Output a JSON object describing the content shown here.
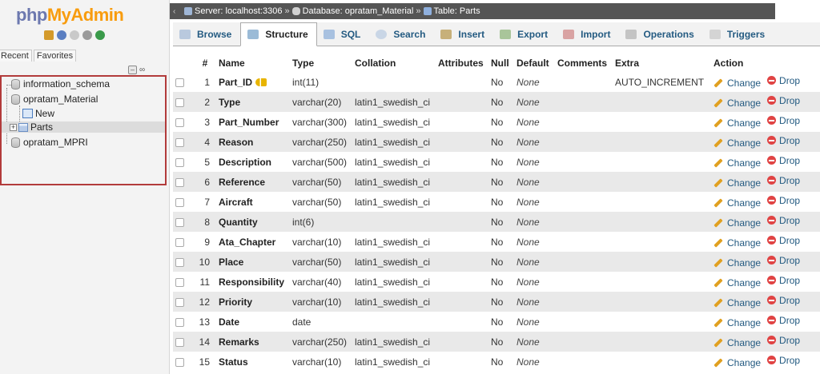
{
  "app": {
    "logo_php": "php",
    "logo_myadmin": "MyAdmin"
  },
  "nav": {
    "tabs": [
      "Recent",
      "Favorites"
    ],
    "databases": [
      {
        "name": "information_schema"
      },
      {
        "name": "opratam_Material"
      },
      {
        "name": "New"
      },
      {
        "name": "Parts"
      },
      {
        "name": "opratam_MPRI"
      }
    ]
  },
  "breadcrumb": {
    "server": "Server: localhost:3306",
    "database": "Database: opratam_Material",
    "table": "Table: Parts",
    "separator": "»"
  },
  "tabs": [
    {
      "label": "Browse",
      "icon": "browse-icon"
    },
    {
      "label": "Structure",
      "icon": "structure-icon",
      "active": true
    },
    {
      "label": "SQL",
      "icon": "sql-icon"
    },
    {
      "label": "Search",
      "icon": "search-icon"
    },
    {
      "label": "Insert",
      "icon": "insert-icon"
    },
    {
      "label": "Export",
      "icon": "export-icon"
    },
    {
      "label": "Import",
      "icon": "import-icon"
    },
    {
      "label": "Operations",
      "icon": "operations-icon"
    },
    {
      "label": "Triggers",
      "icon": "triggers-icon"
    }
  ],
  "table": {
    "headers": [
      "#",
      "Name",
      "Type",
      "Collation",
      "Attributes",
      "Null",
      "Default",
      "Comments",
      "Extra",
      "Action"
    ],
    "action_change": "Change",
    "action_drop": "Drop",
    "rows": [
      {
        "num": "1",
        "name": "Part_ID",
        "type": "int(11)",
        "collation": "",
        "null": "No",
        "default": "None",
        "extra": "AUTO_INCREMENT",
        "primary": true
      },
      {
        "num": "2",
        "name": "Type",
        "type": "varchar(20)",
        "collation": "latin1_swedish_ci",
        "null": "No",
        "default": "None",
        "extra": ""
      },
      {
        "num": "3",
        "name": "Part_Number",
        "type": "varchar(300)",
        "collation": "latin1_swedish_ci",
        "null": "No",
        "default": "None",
        "extra": ""
      },
      {
        "num": "4",
        "name": "Reason",
        "type": "varchar(250)",
        "collation": "latin1_swedish_ci",
        "null": "No",
        "default": "None",
        "extra": ""
      },
      {
        "num": "5",
        "name": "Description",
        "type": "varchar(500)",
        "collation": "latin1_swedish_ci",
        "null": "No",
        "default": "None",
        "extra": ""
      },
      {
        "num": "6",
        "name": "Reference",
        "type": "varchar(50)",
        "collation": "latin1_swedish_ci",
        "null": "No",
        "default": "None",
        "extra": ""
      },
      {
        "num": "7",
        "name": "Aircraft",
        "type": "varchar(50)",
        "collation": "latin1_swedish_ci",
        "null": "No",
        "default": "None",
        "extra": ""
      },
      {
        "num": "8",
        "name": "Quantity",
        "type": "int(6)",
        "collation": "",
        "null": "No",
        "default": "None",
        "extra": ""
      },
      {
        "num": "9",
        "name": "Ata_Chapter",
        "type": "varchar(10)",
        "collation": "latin1_swedish_ci",
        "null": "No",
        "default": "None",
        "extra": ""
      },
      {
        "num": "10",
        "name": "Place",
        "type": "varchar(50)",
        "collation": "latin1_swedish_ci",
        "null": "No",
        "default": "None",
        "extra": ""
      },
      {
        "num": "11",
        "name": "Responsibility",
        "type": "varchar(40)",
        "collation": "latin1_swedish_ci",
        "null": "No",
        "default": "None",
        "extra": ""
      },
      {
        "num": "12",
        "name": "Priority",
        "type": "varchar(10)",
        "collation": "latin1_swedish_ci",
        "null": "No",
        "default": "None",
        "extra": ""
      },
      {
        "num": "13",
        "name": "Date",
        "type": "date",
        "collation": "",
        "null": "No",
        "default": "None",
        "extra": ""
      },
      {
        "num": "14",
        "name": "Remarks",
        "type": "varchar(250)",
        "collation": "latin1_swedish_ci",
        "null": "No",
        "default": "None",
        "extra": ""
      },
      {
        "num": "15",
        "name": "Status",
        "type": "varchar(10)",
        "collation": "latin1_swedish_ci",
        "null": "No",
        "default": "None",
        "extra": ""
      }
    ]
  },
  "colors": {
    "link": "#235a81",
    "logo_php": "#6c78af",
    "logo_myadmin": "#f89c0e",
    "highlight_border": "#b23b3b",
    "drop": "#e04343"
  }
}
